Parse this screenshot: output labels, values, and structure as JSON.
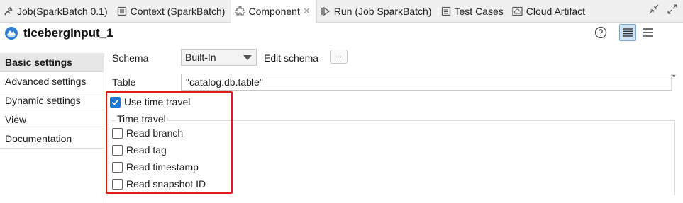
{
  "tabs": [
    {
      "label": "Job(SparkBatch 0.1)",
      "icon": "job-icon"
    },
    {
      "label": "Context (SparkBatch)",
      "icon": "context-icon"
    },
    {
      "label": "Component",
      "icon": "component-icon",
      "active": true
    },
    {
      "label": "Run (Job SparkBatch)",
      "icon": "run-icon"
    },
    {
      "label": "Test Cases",
      "icon": "test-cases-icon"
    },
    {
      "label": "Cloud Artifact",
      "icon": "cloud-artifact-icon"
    }
  ],
  "component": {
    "title": "tIcebergInput_1"
  },
  "sidenav": {
    "items": [
      {
        "label": "Basic settings"
      },
      {
        "label": "Advanced settings"
      },
      {
        "label": "Dynamic settings"
      },
      {
        "label": "View"
      },
      {
        "label": "Documentation"
      }
    ]
  },
  "settings": {
    "schema_label": "Schema",
    "schema_value": "Built-In",
    "edit_schema_label": "Edit schema",
    "edit_schema_button": "...",
    "table_label": "Table",
    "table_value": "\"catalog.db.table\"",
    "required_marker": "*",
    "use_time_travel": {
      "label": "Use time travel",
      "checked": true
    },
    "time_travel_group": {
      "legend": "Time travel",
      "options": [
        {
          "label": "Read branch",
          "checked": false
        },
        {
          "label": "Read tag",
          "checked": false
        },
        {
          "label": "Read timestamp",
          "checked": false
        },
        {
          "label": "Read snapshot ID",
          "checked": false
        }
      ]
    }
  },
  "colors": {
    "accent": "#1976d2",
    "highlight": "#e01b1b"
  }
}
